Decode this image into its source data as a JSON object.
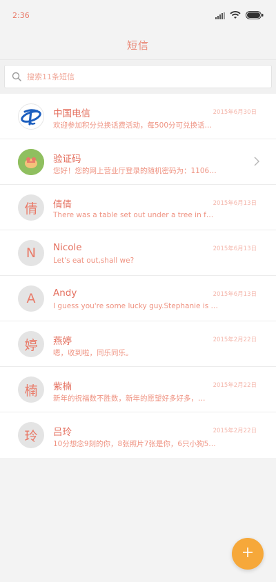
{
  "status_bar": {
    "time": "2:36"
  },
  "header": {
    "title": "短信"
  },
  "search": {
    "placeholder": "搜索11条短信"
  },
  "conversations": [
    {
      "name": "中国电信",
      "preview": "欢迎参加积分兑换话费活动，每500分可兑换话…",
      "date": "2015年6月30日",
      "avatar_type": "logo",
      "avatar_icon": "china-telecom-logo-icon"
    },
    {
      "name": "验证码",
      "preview": "您好！您的网上营业厅登录的随机密码为：1106…",
      "date": "",
      "avatar_type": "image",
      "avatar_icon": "verification-code-avatar-icon",
      "has_chevron": true
    },
    {
      "name": "倩倩",
      "preview": "There was a table set out under a tree in f…",
      "date": "2015年6月13日",
      "avatar_letter": "倩"
    },
    {
      "name": "Nicole",
      "preview": "Let's eat out,shall we?",
      "date": "2015年6月13日",
      "avatar_letter": "N"
    },
    {
      "name": "Andy",
      "preview": "I guess you're some lucky guy.Stephanie is …",
      "date": "2015年6月13日",
      "avatar_letter": "A"
    },
    {
      "name": "燕婷",
      "preview": "嗯，收到啦，同乐同乐。",
      "date": "2015年2月22日",
      "avatar_letter": "婷"
    },
    {
      "name": "紫楠",
      "preview": "新年的祝福数不胜数，新年的愿望好多好多，…",
      "date": "2015年2月22日",
      "avatar_letter": "楠"
    },
    {
      "name": "吕玲",
      "preview": "10分想念9刻的你，8张照片7张是你，6只小狗5…",
      "date": "2015年2月22日",
      "avatar_letter": "玲"
    }
  ],
  "colors": {
    "accent_text": "#e46f5e",
    "fab": "#f6a83a",
    "background": "#f3f3f3"
  }
}
